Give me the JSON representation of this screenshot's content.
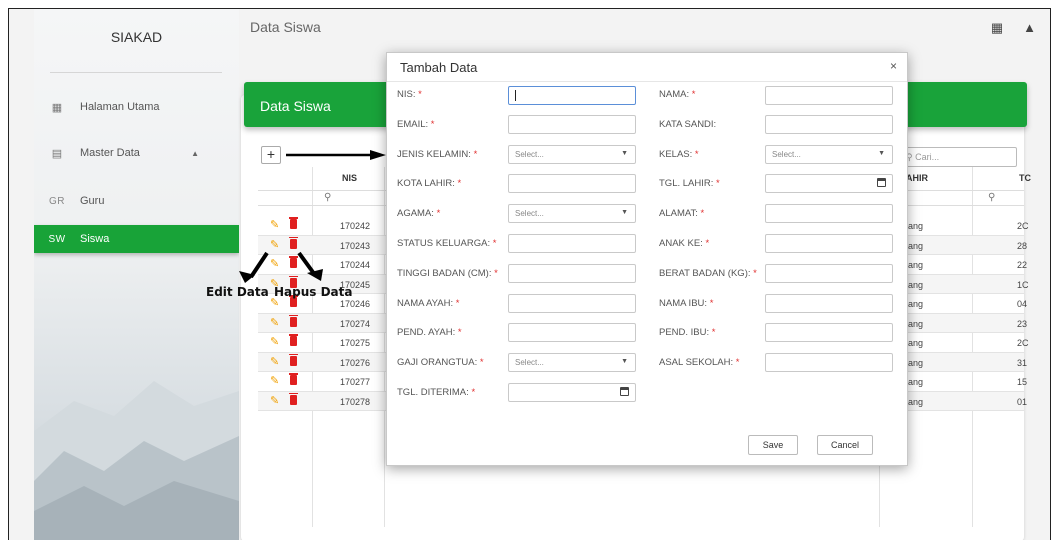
{
  "sidebar": {
    "brand": "SIAKAD",
    "items": [
      {
        "icon": "dashboard-icon",
        "abbr": "",
        "label": "Halaman Utama"
      },
      {
        "icon": "clipboard-icon",
        "abbr": "",
        "label": "Master Data"
      },
      {
        "icon": "",
        "abbr": "GR",
        "label": "Guru"
      },
      {
        "icon": "",
        "abbr": "SW",
        "label": "Siswa",
        "active": true
      }
    ]
  },
  "topbar": {
    "title": "Data Siswa"
  },
  "card": {
    "title": "Data Siswa",
    "add_label": "+",
    "search_placeholder": "Cari..."
  },
  "table": {
    "columns": {
      "nis": "NIS",
      "tgl_lahir": "AHIR",
      "tc": "TC"
    },
    "rows": [
      {
        "nis": "170242",
        "tail": "ang",
        "tc": "2C"
      },
      {
        "nis": "170243",
        "tail": "ang",
        "tc": "28"
      },
      {
        "nis": "170244",
        "tail": "ang",
        "tc": "22"
      },
      {
        "nis": "170245",
        "tail": "ang",
        "tc": "1C"
      },
      {
        "nis": "170246",
        "tail": "ang",
        "tc": "04"
      },
      {
        "nis": "170274",
        "tail": "ang",
        "tc": "23"
      },
      {
        "nis": "170275",
        "tail": "ang",
        "tc": "2C"
      },
      {
        "nis": "170276",
        "tail": "ang",
        "tc": "31"
      },
      {
        "nis": "170277",
        "tail": "ang",
        "tc": "15"
      },
      {
        "nis": "170278",
        "tail": "ang",
        "tc": "01"
      }
    ]
  },
  "annotations": {
    "edit": "Edit Data",
    "hapus": "Hapus Data"
  },
  "modal": {
    "title": "Tambah Data",
    "close": "×",
    "save": "Save",
    "cancel": "Cancel",
    "select_placeholder": "Select...",
    "fields": {
      "nis": "NIS:",
      "nama": "NAMA:",
      "email": "EMAIL:",
      "kata_sandi": "KATA SANDI:",
      "jenis_kelamin": "JENIS KELAMIN:",
      "kelas": "KELAS:",
      "kota_lahir": "KOTA LAHIR:",
      "tgl_lahir": "TGL. LAHIR:",
      "agama": "AGAMA:",
      "alamat": "ALAMAT:",
      "status_keluarga": "STATUS KELUARGA:",
      "anak_ke": "ANAK KE:",
      "tinggi_badan": "TINGGI BADAN (CM):",
      "berat_badan": "BERAT BADAN (KG):",
      "nama_ayah": "NAMA AYAH:",
      "nama_ibu": "NAMA IBU:",
      "pend_ayah": "PEND. AYAH:",
      "pend_ibu": "PEND. IBU:",
      "gaji_orangtua": "GAJI ORANGTUA:",
      "asal_sekolah": "ASAL SEKOLAH:",
      "tgl_diterima": "TGL. DITERIMA:"
    },
    "required_mark": "*"
  },
  "colors": {
    "accent": "#19a33a",
    "edit": "#f0a000",
    "delete": "#e02020"
  }
}
